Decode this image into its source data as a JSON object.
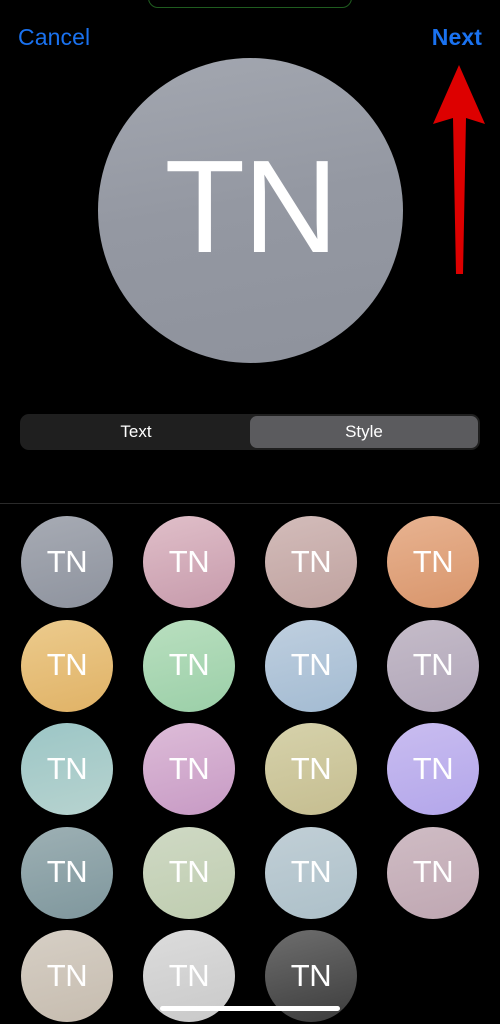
{
  "app": {
    "platform": "ios",
    "screen_title": "Avatar Style Picker",
    "background_color": "#000000"
  },
  "top_stub": {
    "icon": "rounded-rect-outline",
    "color": "#1f5c1f",
    "note": "partially cut-off green rounded outline at top edge"
  },
  "navbar": {
    "cancel_label": "Cancel",
    "next_label": "Next",
    "accent_color": "#1a72f0"
  },
  "preview": {
    "initials": "TN",
    "gradient_from": "#a3a7b0",
    "gradient_to": "#8e929c",
    "text_color": "#ffffff"
  },
  "annotation": {
    "icon": "up-arrow-icon",
    "color": "#dd0000",
    "points_to": "Next"
  },
  "segmented_control": {
    "selected_index": 1,
    "track_color": "#1f1f1f",
    "thumb_color": "#5b5b5e",
    "options": [
      {
        "label": "Text"
      },
      {
        "label": "Style"
      }
    ]
  },
  "style_grid": {
    "initials": "TN",
    "columns": 4,
    "swatches": [
      {
        "row": 1,
        "col": 1,
        "name": "slate-blue-gray",
        "from": "#a7abb4",
        "to": "#8e939e"
      },
      {
        "row": 1,
        "col": 2,
        "name": "rose-pink",
        "from": "#e0bfc9",
        "to": "#c69aab"
      },
      {
        "row": 1,
        "col": 3,
        "name": "dusty-rose",
        "from": "#d3bcba",
        "to": "#bfa29f"
      },
      {
        "row": 1,
        "col": 4,
        "name": "peach-orange",
        "from": "#e8b391",
        "to": "#d8956b"
      },
      {
        "row": 2,
        "col": 1,
        "name": "golden-yellow",
        "from": "#eccb8d",
        "to": "#e0b266"
      },
      {
        "row": 2,
        "col": 2,
        "name": "mint-green",
        "from": "#b9dfbf",
        "to": "#9bcfa8"
      },
      {
        "row": 2,
        "col": 3,
        "name": "powder-blue",
        "from": "#bfcfdf",
        "to": "#a3bbd2"
      },
      {
        "row": 2,
        "col": 4,
        "name": "lavender-gray",
        "from": "#c5bcc9",
        "to": "#b0a5b8"
      },
      {
        "row": 3,
        "col": 1,
        "name": "teal-aqua",
        "from": "#9cc6c6",
        "to": "#b7d3cf"
      },
      {
        "row": 3,
        "col": 2,
        "name": "orchid-pink",
        "from": "#ddbcd8",
        "to": "#c79ac4"
      },
      {
        "row": 3,
        "col": 3,
        "name": "khaki-olive",
        "from": "#d6d2ab",
        "to": "#c5bd90"
      },
      {
        "row": 3,
        "col": 4,
        "name": "periwinkle-purple",
        "from": "#c9bdf0",
        "to": "#b3a6ea"
      },
      {
        "row": 4,
        "col": 1,
        "name": "slate-teal",
        "from": "#9db0b4",
        "to": "#7f979d"
      },
      {
        "row": 4,
        "col": 2,
        "name": "sage-green",
        "from": "#cfd9c4",
        "to": "#bfcdb0"
      },
      {
        "row": 4,
        "col": 3,
        "name": "pale-blue-gray",
        "from": "#c1cfd6",
        "to": "#adc0c9"
      },
      {
        "row": 4,
        "col": 4,
        "name": "mauve-dusty-pink",
        "from": "#cfbcc4",
        "to": "#bfa7b2"
      },
      {
        "row": 5,
        "col": 1,
        "name": "beige-taupe",
        "from": "#d6cfc5",
        "to": "#c6bcaf"
      },
      {
        "row": 5,
        "col": 2,
        "name": "light-gray",
        "from": "#dcdcdc",
        "to": "#c9c9c9"
      },
      {
        "row": 5,
        "col": 3,
        "name": "dark-gray",
        "from": "#6e6e6e",
        "to": "#3c3c3c"
      }
    ]
  },
  "home_indicator": {
    "icon": "home-indicator-bar",
    "color": "#ffffff"
  }
}
